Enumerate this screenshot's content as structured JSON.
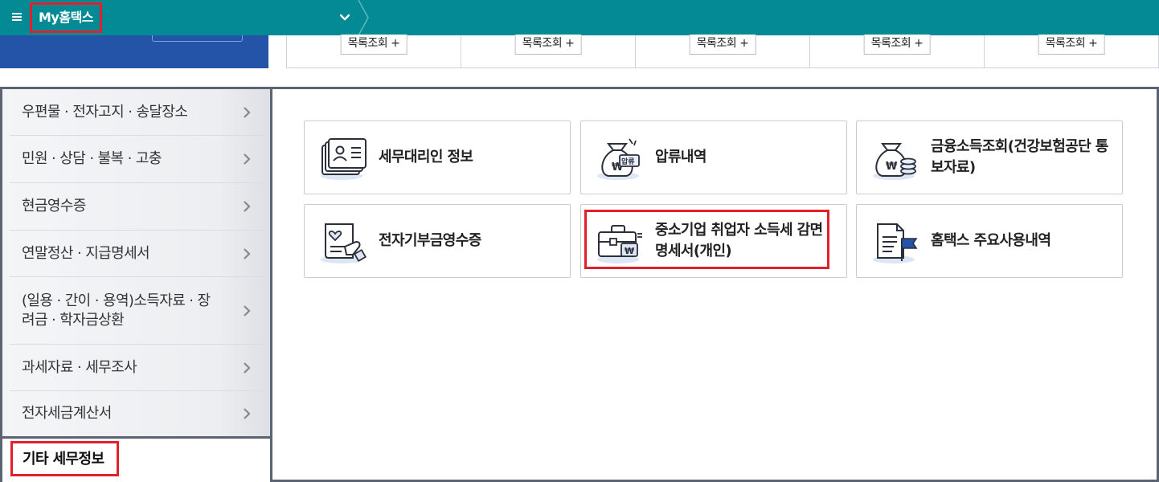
{
  "header": {
    "brand": "My홈택스",
    "menu_icon": "hamburger-icon",
    "dropdown_icon": "chevron-down-icon",
    "bar_color": "#038a95"
  },
  "list_buttons": [
    "목록조회 +",
    "목록조회 +",
    "목록조회 +",
    "목록조회 +",
    "목록조회 +"
  ],
  "sidebar": {
    "items": [
      {
        "label": "우편물 · 전자고지 · 송달장소"
      },
      {
        "label": "민원 · 상담 · 불복 · 고충"
      },
      {
        "label": "현금영수증"
      },
      {
        "label": "연말정산 · 지급명세서"
      },
      {
        "label": "(일용 · 간이 · 용역)소득자료 · 장려금 · 학자금상환"
      },
      {
        "label": "과세자료 · 세무조사"
      },
      {
        "label": "전자세금계산서"
      }
    ],
    "footer": "기타 세무정보"
  },
  "cards": [
    {
      "label": "세무대리인 정보",
      "icon": "id-card-icon"
    },
    {
      "label": "압류내역",
      "icon": "money-bag-seized-icon"
    },
    {
      "label": "금융소득조회(건강보험공단 통보자료)",
      "icon": "money-bag-coins-icon"
    },
    {
      "label": "전자기부금영수증",
      "icon": "donation-receipt-icon"
    },
    {
      "label": "중소기업 취업자 소득세 감면 명세서(개인)",
      "icon": "briefcase-won-icon"
    },
    {
      "label": "홈택스 주요사용내역",
      "icon": "document-flag-icon"
    }
  ],
  "icon_text": {
    "seized": "압류",
    "won": "₩"
  },
  "colors": {
    "highlight": "#e0202b",
    "accent_blue": "#2354a8"
  }
}
